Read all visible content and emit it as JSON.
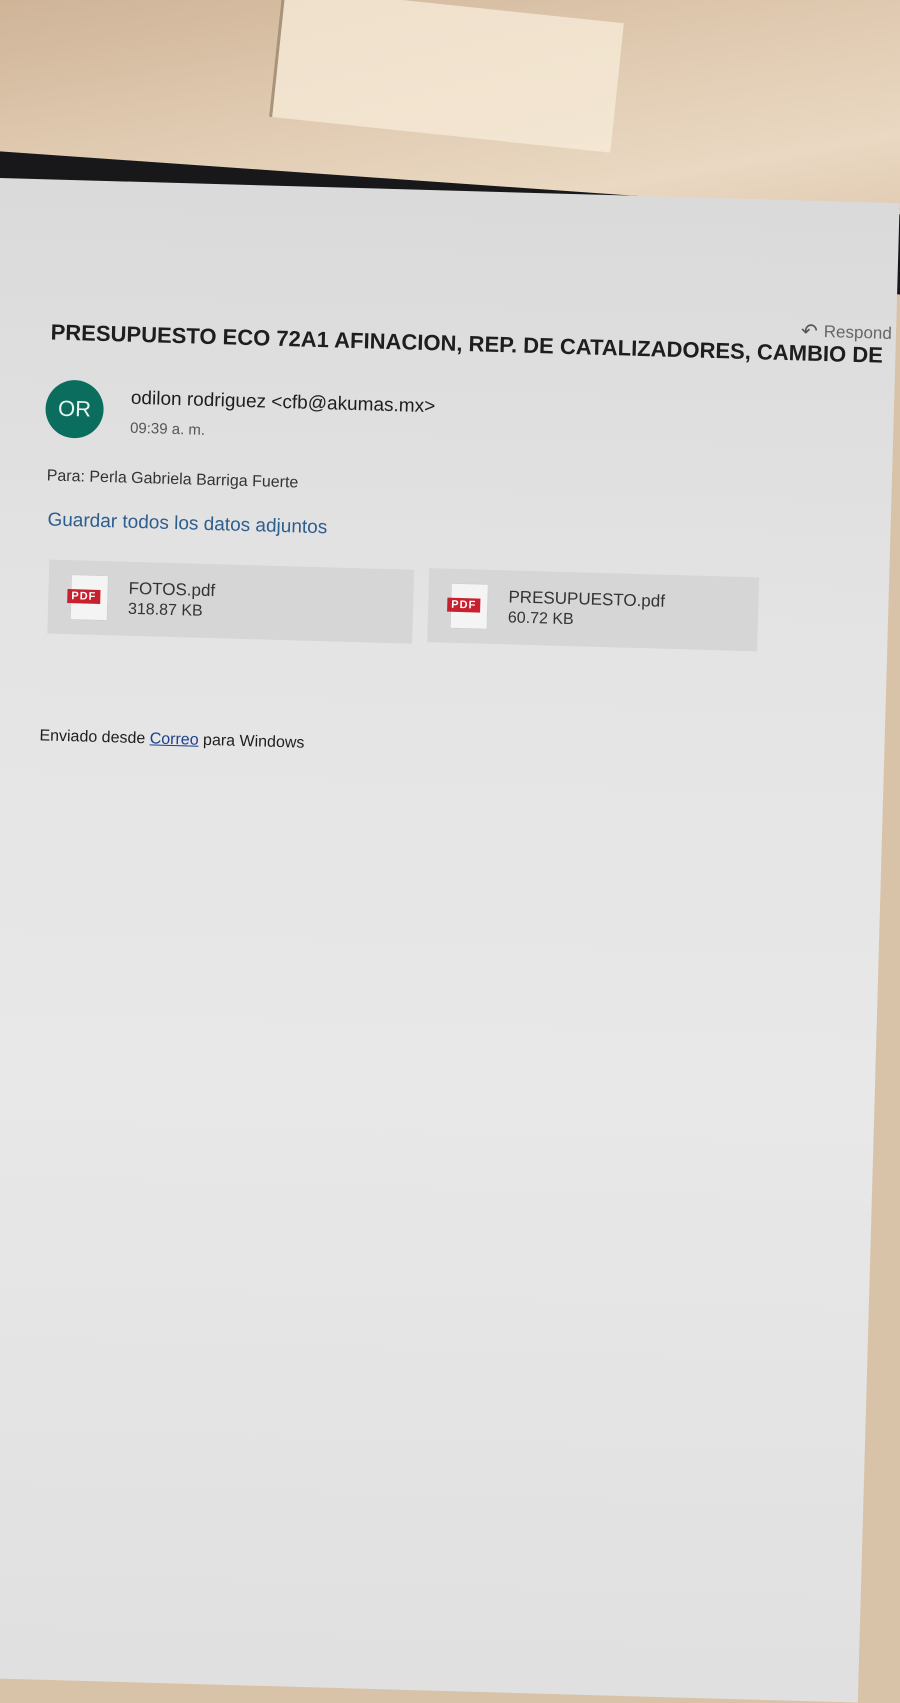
{
  "toolbar": {
    "reply_label": "Respond"
  },
  "message": {
    "subject": "PRESUPUESTO ECO 72A1 AFINACION, REP. DE CATALIZADORES, CAMBIO DE",
    "avatar_initials": "OR",
    "sender": "odilon rodriguez <cfb@akumas.mx>",
    "time": "09:39 a. m.",
    "to_label": "Para:",
    "to_value": "Perla Gabriela Barriga Fuerte",
    "save_all_label": "Guardar todos los datos adjuntos",
    "attachments": [
      {
        "name": "FOTOS.pdf",
        "size": "318.87 KB",
        "icon": "pdf-file-icon",
        "badge": "PDF"
      },
      {
        "name": "PRESUPUESTO.pdf",
        "size": "60.72 KB",
        "icon": "pdf-file-icon",
        "badge": "PDF"
      }
    ],
    "signature": {
      "prefix": "Enviado desde",
      "link": "Correo",
      "suffix": "para Windows"
    }
  },
  "colors": {
    "avatar_bg": "#0b6d5e",
    "link": "#2d5d8e",
    "pdf_badge": "#c8202e"
  }
}
